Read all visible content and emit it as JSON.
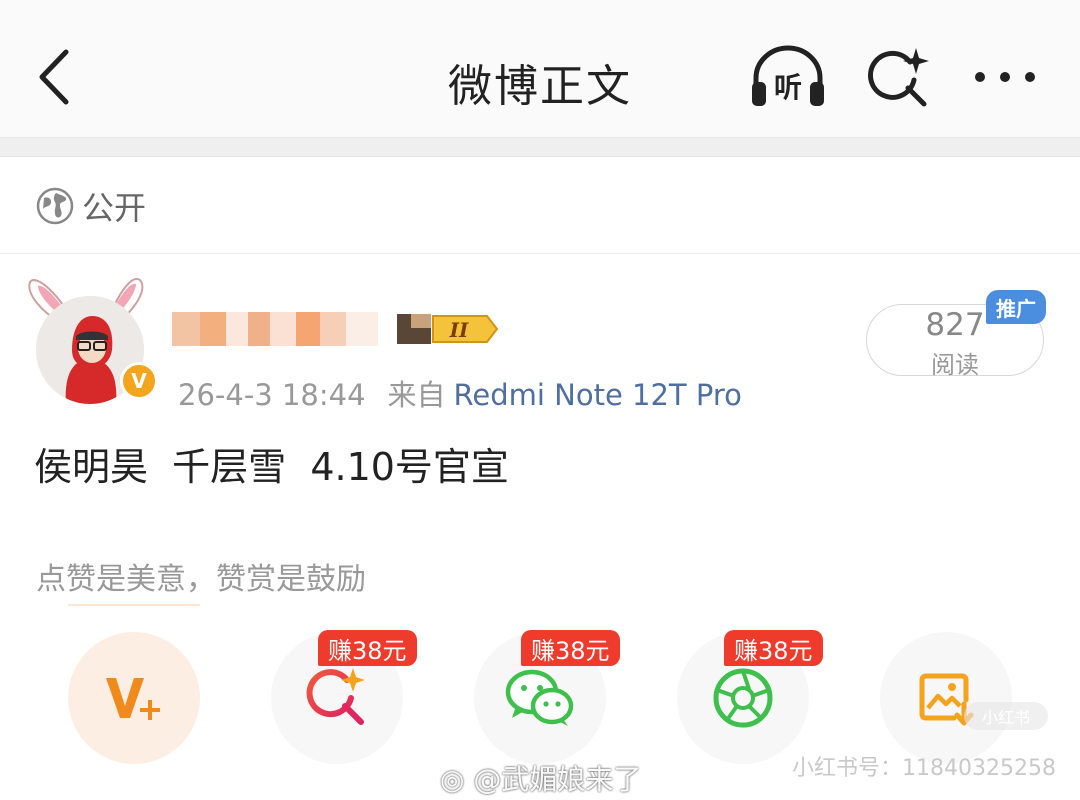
{
  "header": {
    "title": "微博正文",
    "back_icon": "chevron-left-icon",
    "listen_label": "听",
    "actions": [
      "headphones-listen-icon",
      "sparkle-search-icon",
      "more-dots-icon"
    ]
  },
  "visibility": {
    "icon": "globe-icon",
    "label": "公开"
  },
  "post": {
    "author": {
      "avatar": "avatar-bunny-ears",
      "verified_badge": "V",
      "member_badge": "II"
    },
    "timestamp": "26-4-3 18:44",
    "source_prefix": "来自",
    "device": "Redmi Note 12T Pro",
    "reads": {
      "count": "827",
      "label": "阅读",
      "promo_tag": "推广"
    },
    "text": "侯明昊  千层雪  4.10号官宣"
  },
  "reward": {
    "hint": "点赞是美意，赞赏是鼓励",
    "actions": [
      {
        "name": "vip-plus",
        "icon": "v-plus-icon",
        "tag": ""
      },
      {
        "name": "spark-search",
        "icon": "sparkle-search-icon",
        "tag": "赚38元"
      },
      {
        "name": "wechat",
        "icon": "wechat-icon",
        "tag": "赚38元"
      },
      {
        "name": "moments",
        "icon": "moments-shutter-icon",
        "tag": "赚38元"
      },
      {
        "name": "save-image",
        "icon": "image-download-icon",
        "tag": ""
      }
    ]
  },
  "watermarks": {
    "weibo": "@武媚娘来了",
    "xhs_id": "小红书号：11840325258",
    "xhs_logo": "小红书"
  },
  "colors": {
    "accent_orange": "#f08a1c",
    "earn_red": "#ef3b2c",
    "device_blue": "#4f6fa0",
    "promo_blue": "#4b8ee0",
    "wechat_green": "#3fbf4c"
  }
}
